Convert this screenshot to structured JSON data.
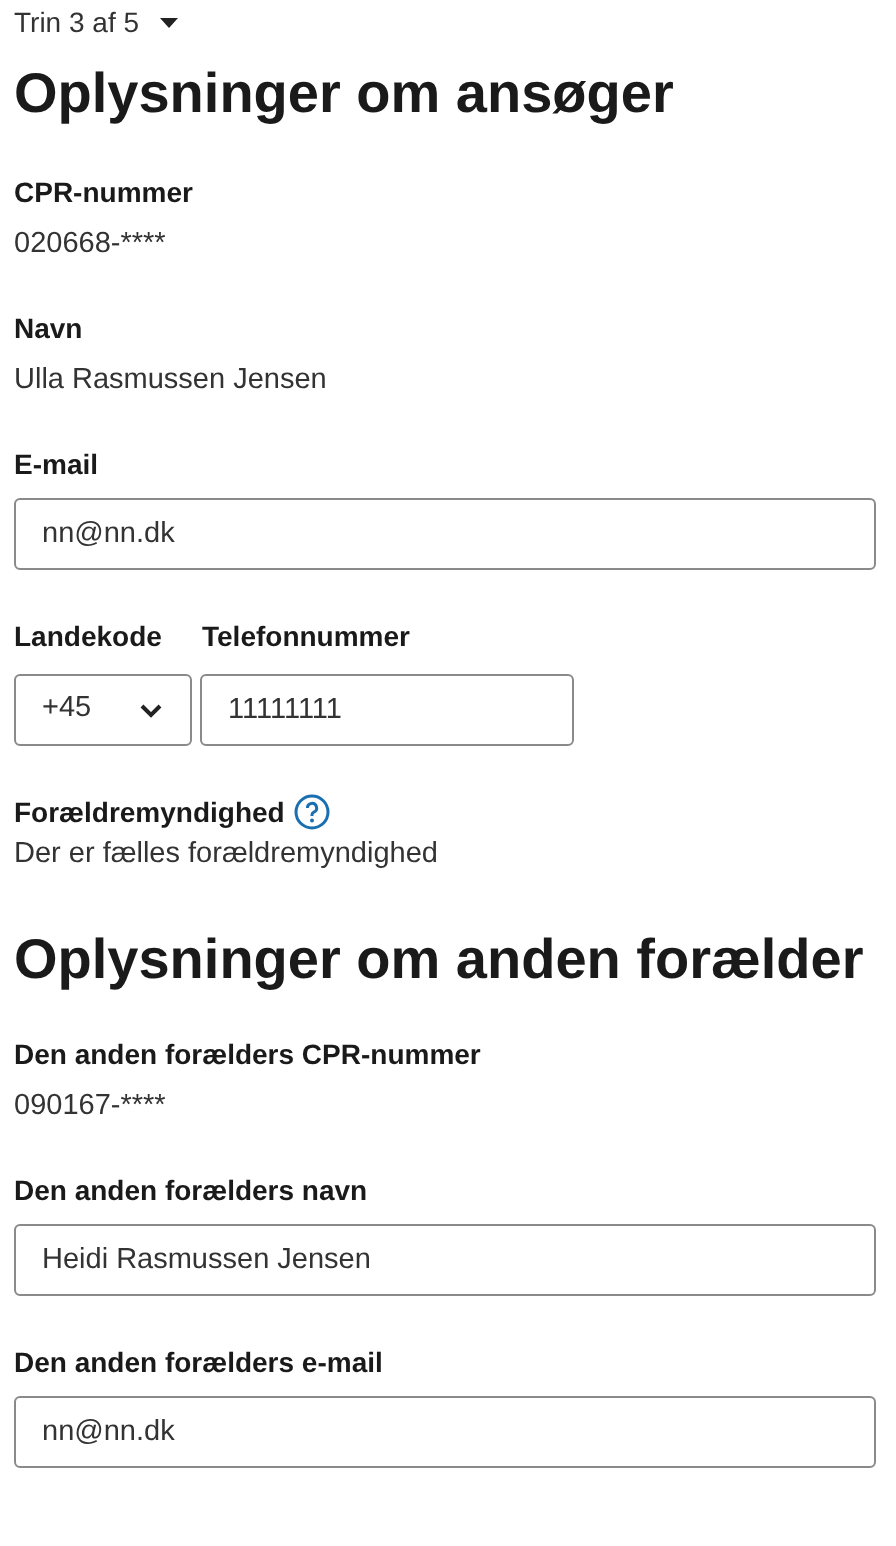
{
  "step": {
    "label": "Trin 3 af 5"
  },
  "sections": [
    {
      "title": "Oplysninger om ansøger",
      "fields": [
        {
          "kind": "text",
          "label": "CPR-nummer",
          "value": "020668-****"
        },
        {
          "kind": "text",
          "label": "Navn",
          "value": "Ulla Rasmussen Jensen"
        },
        {
          "kind": "input",
          "label": "E-mail",
          "value": "nn@nn.dk"
        },
        {
          "kind": "phone",
          "code_label": "Landekode",
          "code_value": "+45",
          "label": "Telefonnummer",
          "value": "11111111"
        },
        {
          "kind": "help",
          "label": "Forældremyndighed",
          "value": "Der er fælles forældremyndighed"
        }
      ]
    },
    {
      "title": "Oplysninger om anden forælder",
      "fields": [
        {
          "kind": "text",
          "label": "Den anden forælders CPR-nummer",
          "value": "090167-****"
        },
        {
          "kind": "input",
          "label": "Den anden forælders navn",
          "value": "Heidi Rasmussen Jensen"
        },
        {
          "kind": "input",
          "label": "Den anden forælders e-mail",
          "value": "nn@nn.dk"
        }
      ]
    }
  ]
}
